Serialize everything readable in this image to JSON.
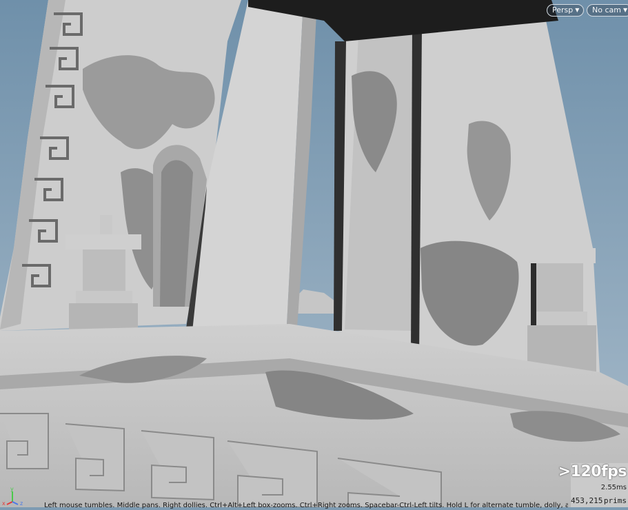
{
  "viewport": {
    "camera_mode": "Persp",
    "camera_select": "No cam",
    "fps": ">120fps",
    "frame_time": "2.55ms",
    "prim_count": "453,215",
    "prim_label": "prims",
    "status_hint": "Left mouse tumbles. Middle pans. Right dollies. Ctrl+Alt+Left box-zooms. Ctrl+Right zooms. Spacebar-Ctrl-Left tilts. Hold L for alternate tumble, dolly, and zoom.",
    "axes": {
      "x": "x",
      "y": "y",
      "z": "z"
    }
  },
  "colors": {
    "sky": "#7d9bb2",
    "clay_light": "#d2d2d2",
    "clay_mid": "#b4b4b4",
    "clay_dark": "#6f6f6f",
    "shadow": "#2b2b2b",
    "axis_x": "#e23b3b",
    "axis_y": "#4ac94a",
    "axis_z": "#4a78e6"
  }
}
